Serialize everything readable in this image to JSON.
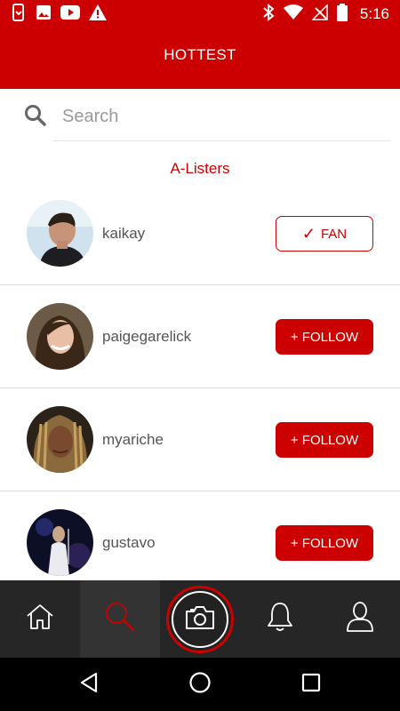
{
  "status_bar": {
    "time": "5:16",
    "left_icons": [
      "device-icon",
      "image-icon",
      "youtube-icon",
      "warning-icon"
    ],
    "right_icons": [
      "bluetooth-icon",
      "wifi-icon",
      "no-signal-icon",
      "battery-icon"
    ]
  },
  "header": {
    "title": "HOTTEST"
  },
  "search": {
    "placeholder": "Search"
  },
  "section": {
    "title": "A-Listers"
  },
  "users": [
    {
      "username": "kaikay",
      "button_label": "FAN",
      "button_prefix": "✓",
      "state": "fan"
    },
    {
      "username": "paigegarelick",
      "button_label": "+ FOLLOW",
      "state": "follow"
    },
    {
      "username": "myariche",
      "button_label": "+ FOLLOW",
      "state": "follow"
    },
    {
      "username": "gustavo",
      "button_label": "+ FOLLOW",
      "state": "follow"
    }
  ],
  "tabs": [
    {
      "name": "home",
      "icon": "home-icon"
    },
    {
      "name": "search",
      "icon": "search-icon",
      "active": true
    },
    {
      "name": "camera",
      "icon": "camera-icon"
    },
    {
      "name": "notifications",
      "icon": "bell-icon"
    },
    {
      "name": "profile",
      "icon": "user-icon"
    }
  ],
  "colors": {
    "brand": "#cc0000",
    "tabbar": "#262626",
    "navbar": "#000000"
  }
}
